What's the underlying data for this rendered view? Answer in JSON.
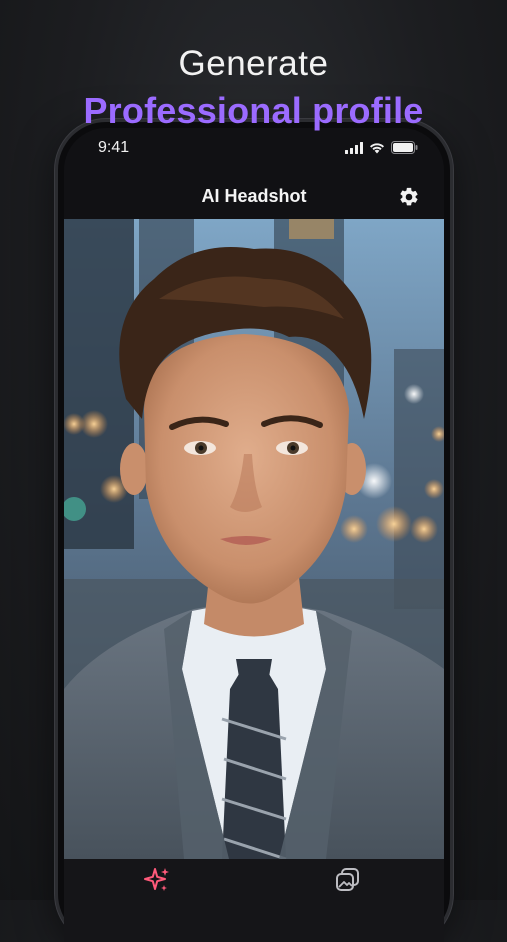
{
  "promo": {
    "line1": "Generate",
    "line2": "Professional profile",
    "accent_color": "#9b6bff"
  },
  "status_bar": {
    "time": "9:41",
    "icons": [
      "cellular-signal-icon",
      "wifi-icon",
      "battery-icon"
    ]
  },
  "nav": {
    "title": "AI Headshot",
    "settings_icon": "gear-icon"
  },
  "main": {
    "photo_subject": "headshot-photo"
  },
  "tab_bar": {
    "tabs": [
      {
        "icon": "sparkles-icon",
        "active": true,
        "color": "#ff5a7a"
      },
      {
        "icon": "gallery-stack-icon",
        "active": false,
        "color": "#bdbdc2"
      }
    ]
  }
}
